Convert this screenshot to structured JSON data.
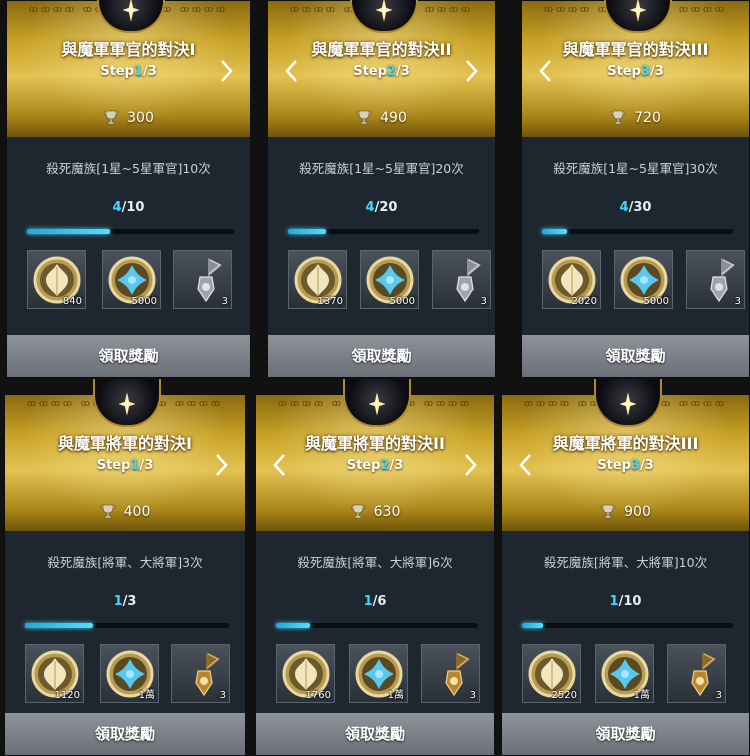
{
  "ornament_text": "ꝏꝏꝏꝏ ꝏꝏꝏꝏ",
  "colors": {
    "highlight": "#3fd7ff",
    "gold": "#e3c253",
    "panel": "#1e2730",
    "claim_button": "#7d8289"
  },
  "cards": [
    {
      "title": "與魔軍軍官的對決I",
      "step_prefix": "Step",
      "step_current": "1",
      "step_total": "/3",
      "points": "300",
      "task": "殺死魔族[1星~5星軍官]10次",
      "progress_current": "4",
      "progress_total": "/10",
      "progress_ratio": 0.4,
      "rewards": [
        {
          "icon": "gold-leaf-coin-icon",
          "count": "840"
        },
        {
          "icon": "blue-cross-coin-icon",
          "count": "5000"
        },
        {
          "icon": "silver-sword-relic-icon",
          "count": "3"
        }
      ],
      "arrow_left": false,
      "arrow_right": true,
      "claim_label": "領取獎勵"
    },
    {
      "title": "與魔軍軍官的對決II",
      "step_prefix": "Step",
      "step_current": "2",
      "step_total": "/3",
      "points": "490",
      "task": "殺死魔族[1星~5星軍官]20次",
      "progress_current": "4",
      "progress_total": "/20",
      "progress_ratio": 0.2,
      "rewards": [
        {
          "icon": "gold-leaf-coin-icon",
          "count": "1370"
        },
        {
          "icon": "blue-cross-coin-icon",
          "count": "5000"
        },
        {
          "icon": "silver-sword-relic-icon",
          "count": "3"
        }
      ],
      "arrow_left": true,
      "arrow_right": true,
      "claim_label": "領取獎勵"
    },
    {
      "title": "與魔軍軍官的對決III",
      "step_prefix": "Step",
      "step_current": "3",
      "step_total": "/3",
      "points": "720",
      "task": "殺死魔族[1星~5星軍官]30次",
      "progress_current": "4",
      "progress_total": "/30",
      "progress_ratio": 0.133,
      "rewards": [
        {
          "icon": "gold-leaf-coin-icon",
          "count": "2020"
        },
        {
          "icon": "blue-cross-coin-icon",
          "count": "5000"
        },
        {
          "icon": "silver-sword-relic-icon",
          "count": "3"
        }
      ],
      "arrow_left": true,
      "arrow_right": false,
      "claim_label": "領取獎勵"
    },
    {
      "title": "與魔軍將軍的對決I",
      "step_prefix": "Step",
      "step_current": "1",
      "step_total": "/3",
      "points": "400",
      "task": "殺死魔族[將軍、大將軍]3次",
      "progress_current": "1",
      "progress_total": "/3",
      "progress_ratio": 0.333,
      "rewards": [
        {
          "icon": "gold-leaf-coin-icon",
          "count": "1120"
        },
        {
          "icon": "blue-cross-coin-icon",
          "count": "1萬"
        },
        {
          "icon": "gold-sword-relic-icon",
          "count": "3"
        }
      ],
      "arrow_left": false,
      "arrow_right": true,
      "claim_label": "領取獎勵"
    },
    {
      "title": "與魔軍將軍的對決II",
      "step_prefix": "Step",
      "step_current": "2",
      "step_total": "/3",
      "points": "630",
      "task": "殺死魔族[將軍、大將軍]6次",
      "progress_current": "1",
      "progress_total": "/6",
      "progress_ratio": 0.167,
      "rewards": [
        {
          "icon": "gold-leaf-coin-icon",
          "count": "1760"
        },
        {
          "icon": "blue-cross-coin-icon",
          "count": "1萬"
        },
        {
          "icon": "gold-sword-relic-icon",
          "count": "3"
        }
      ],
      "arrow_left": true,
      "arrow_right": true,
      "claim_label": "領取獎勵"
    },
    {
      "title": "與魔軍將軍的對決III",
      "step_prefix": "Step",
      "step_current": "3",
      "step_total": "/3",
      "points": "900",
      "task": "殺死魔族[將軍、大將軍]10次",
      "progress_current": "1",
      "progress_total": "/10",
      "progress_ratio": 0.1,
      "rewards": [
        {
          "icon": "gold-leaf-coin-icon",
          "count": "2520"
        },
        {
          "icon": "blue-cross-coin-icon",
          "count": "1萬"
        },
        {
          "icon": "gold-sword-relic-icon",
          "count": "3"
        }
      ],
      "arrow_left": true,
      "arrow_right": false,
      "claim_label": "領取獎勵"
    }
  ]
}
